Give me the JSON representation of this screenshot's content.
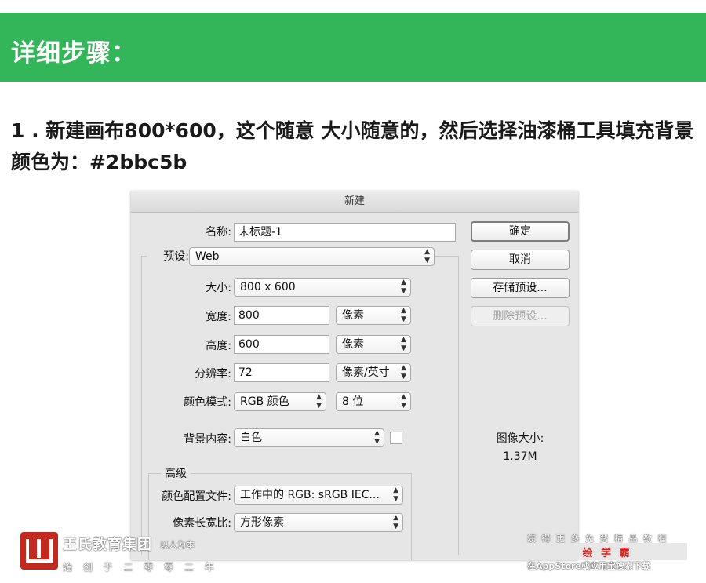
{
  "header": {
    "title": "详细步骤："
  },
  "step": {
    "text": "1 . 新建画布800*600，这个随意  大小随意的，然后选择油漆桶工具填充背景颜色为：#2bbc5b"
  },
  "dialog": {
    "title": "新建",
    "name_label": "名称:",
    "name_value": "未标题-1",
    "preset_label": "预设:",
    "preset_value": "Web",
    "size_label": "大小:",
    "size_value": "800 x 600",
    "width_label": "宽度:",
    "width_value": "800",
    "width_unit": "像素",
    "height_label": "高度:",
    "height_value": "600",
    "height_unit": "像素",
    "resolution_label": "分辨率:",
    "resolution_value": "72",
    "resolution_unit": "像素/英寸",
    "color_mode_label": "颜色模式:",
    "color_mode_value": "RGB 颜色",
    "bit_depth_value": "8 位",
    "background_label": "背景内容:",
    "background_value": "白色",
    "advanced_label": "高级",
    "color_profile_label": "颜色配置文件:",
    "color_profile_value": "工作中的 RGB: sRGB IEC...",
    "pixel_aspect_label": "像素长宽比:",
    "pixel_aspect_value": "方形像素",
    "buttons": {
      "ok": "确定",
      "cancel": "取消",
      "save_preset": "存储预设...",
      "delete_preset": "删除预设..."
    },
    "image_size_label": "图像大小:",
    "image_size_value": "1.37M"
  },
  "watermark_left": {
    "brand": "王氏教育集团",
    "slogan": "以人为本",
    "founded": "始 创 于 二 零 零 二 年"
  },
  "watermark_right": {
    "line1": "获 得 更 多 免 费 精 品 教 程",
    "app": "绘 学 霸",
    "line3": "在AppStore或应用宝搜索下载"
  },
  "colors": {
    "banner": "#33b65a",
    "logo_red": "#c32a1f",
    "app_red": "#d22020"
  }
}
